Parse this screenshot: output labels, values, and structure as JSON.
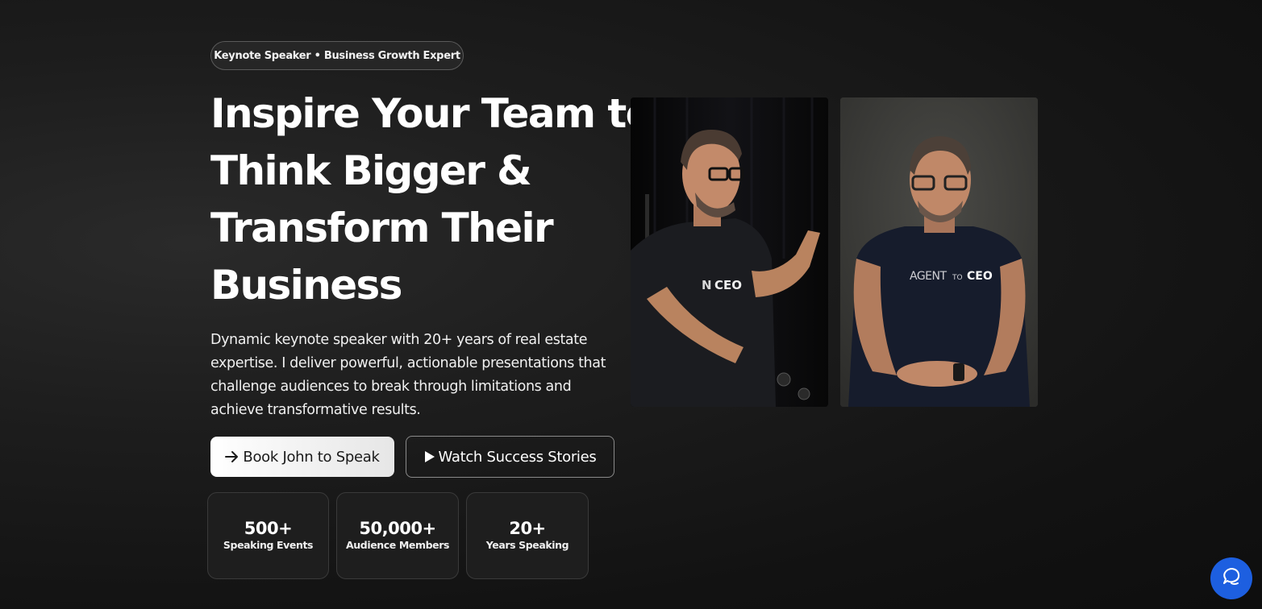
{
  "hero": {
    "badge": "Keynote Speaker • Business Growth Expert",
    "headline_lines": [
      "Inspire Your Team to",
      "Think Bigger &",
      "Transform Their",
      "Business"
    ],
    "description": "Dynamic keynote speaker with 20+ years of real estate expertise. I deliver powerful, actionable presentations that challenge audiences to break through limitations and achieve transformative results.",
    "primary_button": {
      "label": "Book John to Speak",
      "icon": "arrow-right-icon"
    },
    "secondary_button": {
      "label": "Watch Success Stories",
      "icon": "play-icon"
    }
  },
  "stats": [
    {
      "value": "500+",
      "label": "Speaking Events"
    },
    {
      "value": "50,000+",
      "label": "Audience Members"
    },
    {
      "value": "20+",
      "label": "Years Speaking"
    }
  ],
  "photos": {
    "left": {
      "shirt_text": "AGENT TO CEO"
    },
    "right": {
      "shirt_text": "AGENT TO CEO"
    }
  },
  "chat": {
    "icon": "chat-bubble-icon"
  },
  "colors": {
    "background": "#161616",
    "accent_blue": "#1d5fe0",
    "text": "#ffffff"
  }
}
